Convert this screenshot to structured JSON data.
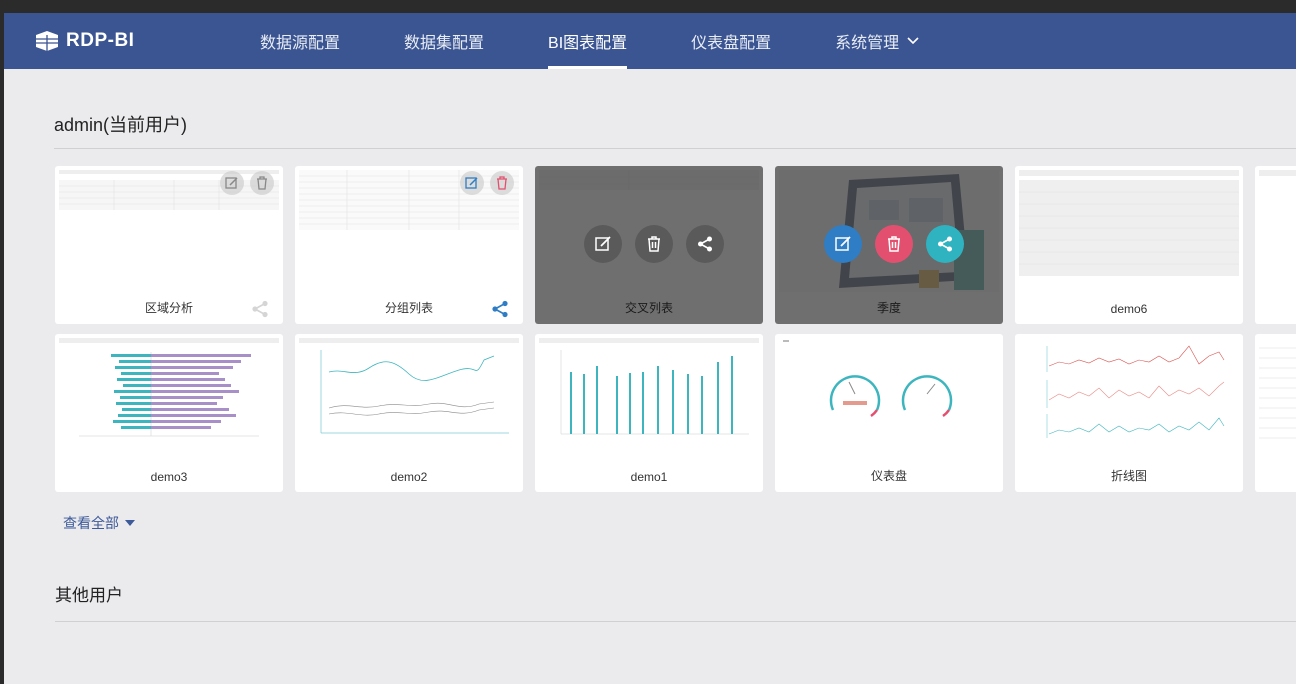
{
  "brand": {
    "name": "RDP-BI"
  },
  "nav": {
    "items": [
      {
        "label": "数据源配置"
      },
      {
        "label": "数据集配置"
      },
      {
        "label": "BI图表配置",
        "active": true
      },
      {
        "label": "仪表盘配置"
      },
      {
        "label": "系统管理",
        "dropdown": true
      }
    ]
  },
  "sections": {
    "current_user": "admin(当前用户)",
    "other_users": "其他用户"
  },
  "cards_row1": [
    {
      "label": "区域分析"
    },
    {
      "label": "分组列表"
    },
    {
      "label": "交叉列表"
    },
    {
      "label": "季度"
    },
    {
      "label": "demo6"
    }
  ],
  "cards_row2": [
    {
      "label": "demo3"
    },
    {
      "label": "demo2"
    },
    {
      "label": "demo1"
    },
    {
      "label": "仪表盘"
    },
    {
      "label": "折线图"
    }
  ],
  "view_all": "查看全部",
  "colors": {
    "header": "#3b5592",
    "edit": "#2f7dc4",
    "delete": "#e3506f",
    "share": "#2fb3c0",
    "chart_teal": "#3cb5bf",
    "chart_purple": "#a98fc7"
  }
}
